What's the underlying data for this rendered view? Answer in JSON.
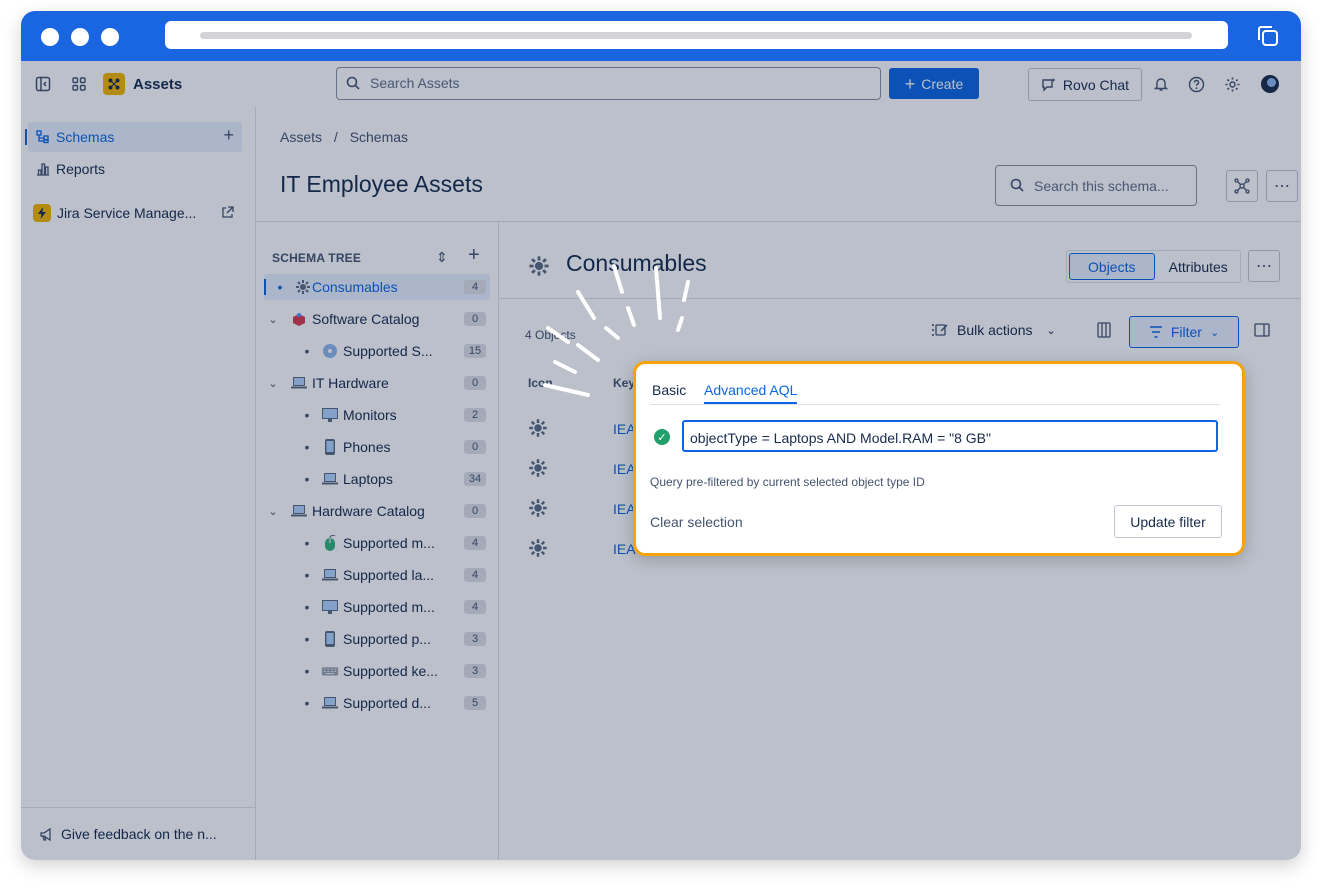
{
  "browser": {
    "window_controls": [
      "close",
      "minimize",
      "maximize"
    ]
  },
  "topnav": {
    "app_name": "Assets",
    "search_placeholder": "Search Assets",
    "create_label": "Create",
    "rovo_label": "Rovo Chat"
  },
  "sidebar": {
    "items": [
      {
        "label": "Schemas",
        "active": true
      },
      {
        "label": "Reports"
      },
      {
        "label": "Jira Service Manage..."
      }
    ],
    "feedback_label": "Give feedback on the n..."
  },
  "main": {
    "breadcrumb": [
      "Assets",
      "Schemas"
    ],
    "title": "IT Employee Assets",
    "schema_search_placeholder": "Search this schema..."
  },
  "tree": {
    "header": "SCHEMA TREE",
    "rows": [
      {
        "label": "Consumables",
        "count": "4",
        "level": 0,
        "active": true
      },
      {
        "label": "Software Catalog",
        "count": "0",
        "level": 0
      },
      {
        "label": "Supported S...",
        "count": "15",
        "level": 1
      },
      {
        "label": "IT Hardware",
        "count": "0",
        "level": 0
      },
      {
        "label": "Monitors",
        "count": "2",
        "level": 1
      },
      {
        "label": "Phones",
        "count": "0",
        "level": 1
      },
      {
        "label": "Laptops",
        "count": "34",
        "level": 1
      },
      {
        "label": "Hardware Catalog",
        "count": "0",
        "level": 0
      },
      {
        "label": "Supported m...",
        "count": "4",
        "level": 1
      },
      {
        "label": "Supported la...",
        "count": "4",
        "level": 1
      },
      {
        "label": "Supported m...",
        "count": "4",
        "level": 1
      },
      {
        "label": "Supported p...",
        "count": "3",
        "level": 1
      },
      {
        "label": "Supported ke...",
        "count": "3",
        "level": 1
      },
      {
        "label": "Supported d...",
        "count": "5",
        "level": 1
      }
    ]
  },
  "content": {
    "title": "Consumables",
    "seg_objects": "Objects",
    "seg_attributes": "Attributes",
    "object_count": "4 Objects",
    "bulk_actions": "Bulk actions",
    "filter_label": "Filter",
    "col_icon": "Icon",
    "col_key": "Key",
    "rows": [
      {
        "key": "IEA"
      },
      {
        "key": "IEA"
      },
      {
        "key": "IEA"
      },
      {
        "key": "IEA-"
      }
    ]
  },
  "popup": {
    "tab_basic": "Basic",
    "tab_advanced": "Advanced AQL",
    "query": "objectType = Laptops AND Model.RAM = \"8 GB\"",
    "hint": "Query pre-filtered by current selected object type ID",
    "clear_label": "Clear selection",
    "update_label": "Update filter"
  },
  "colors": {
    "brand_blue": "#0c66e4",
    "chrome_blue": "#1a66e0",
    "highlight_orange": "#f5a30a",
    "success_green": "#22a06b"
  }
}
